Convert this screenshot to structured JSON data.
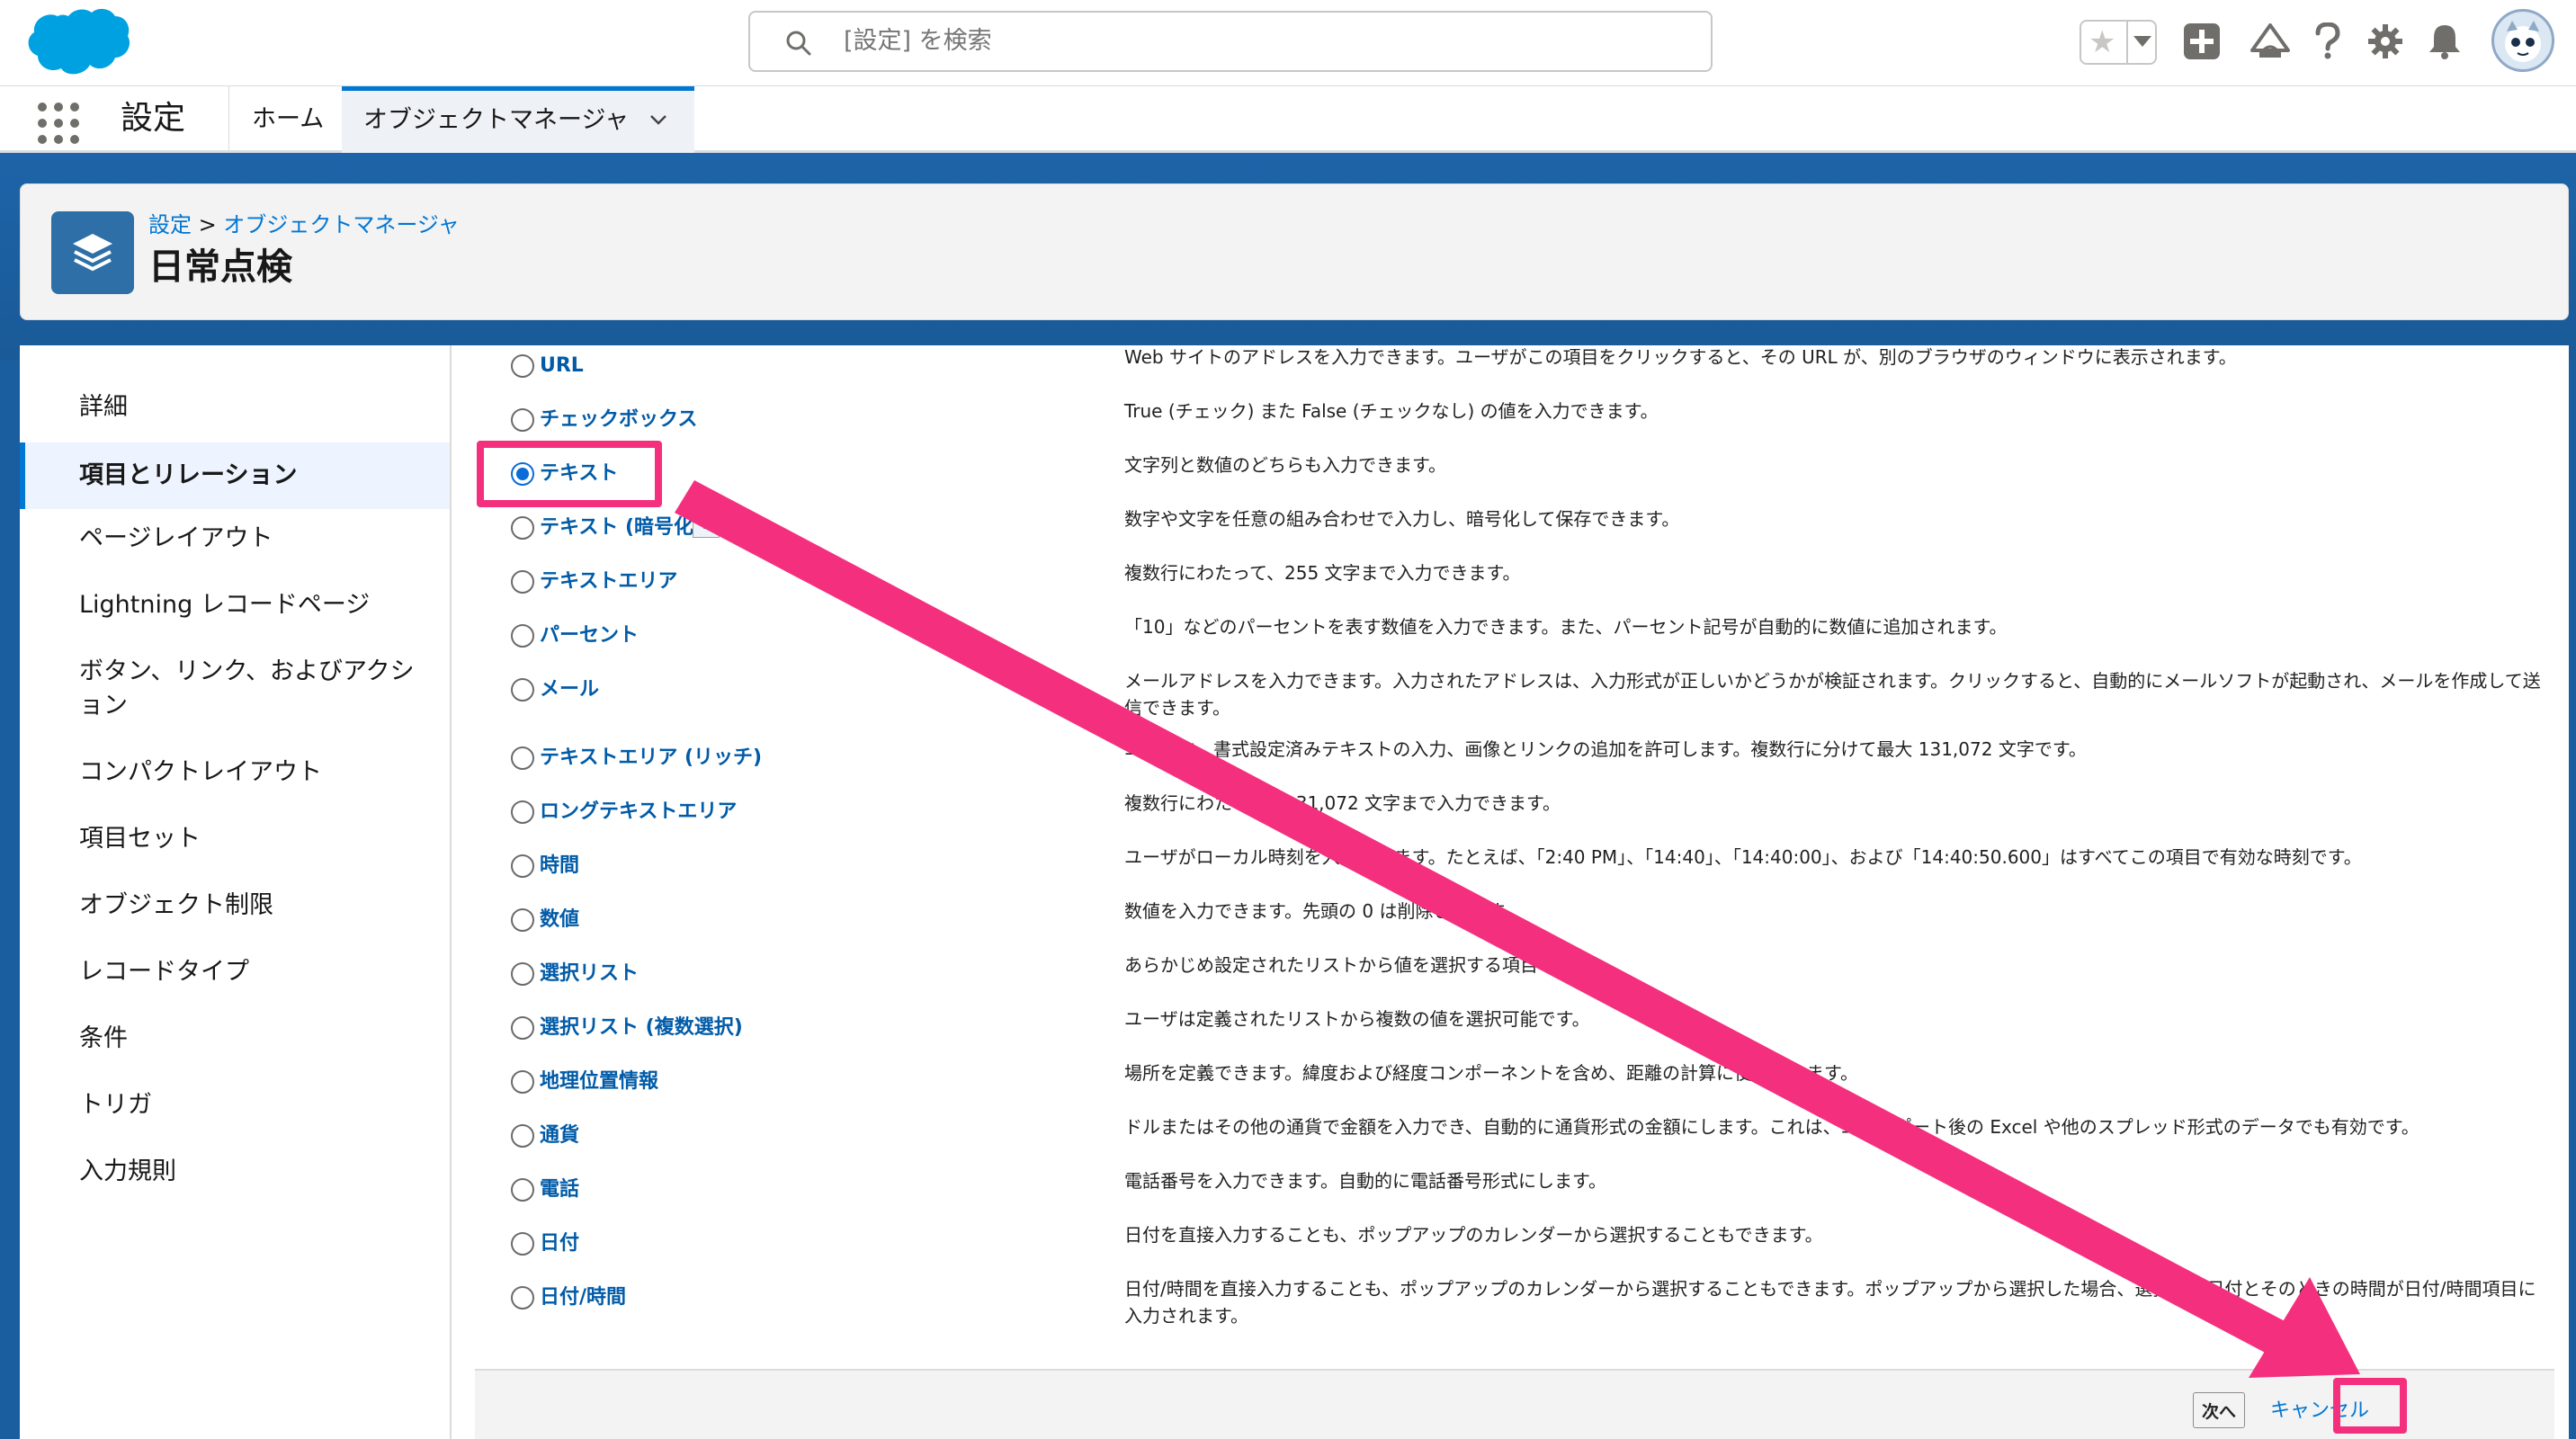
{
  "header": {
    "search_placeholder": "[設定] を検索"
  },
  "context_bar": {
    "app_name": "設定",
    "nav_home": "ホーム",
    "nav_object_manager": "オブジェクトマネージャ"
  },
  "page_header": {
    "breadcrumb_root": "設定",
    "breadcrumb_sep": ">",
    "breadcrumb_current": "オブジェクトマネージャ",
    "title": "日常点検"
  },
  "sidebar": {
    "items": [
      {
        "label": "詳細"
      },
      {
        "label": "項目とリレーション"
      },
      {
        "label": "ページレイアウト"
      },
      {
        "label": "Lightning レコードページ"
      },
      {
        "label": "ボタン、リンク、およびアクション"
      },
      {
        "label": "コンパクトレイアウト"
      },
      {
        "label": "項目セット"
      },
      {
        "label": "オブジェクト制限"
      },
      {
        "label": "レコードタイプ"
      },
      {
        "label": "条件"
      },
      {
        "label": "トリガ"
      },
      {
        "label": "入力規則"
      }
    ],
    "active_index": 1
  },
  "field_types": [
    {
      "label": "URL",
      "desc": "Web サイトのアドレスを入力できます。ユーザがこの項目をクリックすると、その URL が、別のブラウザのウィンドウに表示されます。",
      "checked": false
    },
    {
      "label": "チェックボックス",
      "desc": "True (チェック) また False (チェックなし) の値を入力できます。",
      "checked": false
    },
    {
      "label": "テキスト",
      "desc": "文字列と数値のどちらも入力できます。",
      "checked": true
    },
    {
      "label": "テキスト (暗号化)",
      "desc": "数字や文字を任意の組み合わせで入力し、暗号化して保存できます。",
      "checked": false
    },
    {
      "label": "テキストエリア",
      "desc": "複数行にわたって、255 文字まで入力できます。",
      "checked": false
    },
    {
      "label": "パーセント",
      "desc": "「10」などのパーセントを表す数値を入力できます。また、パーセント記号が自動的に数値に追加されます。",
      "checked": false
    },
    {
      "label": "メール",
      "desc": "メールアドレスを入力できます。入力されたアドレスは、入力形式が正しいかどうかが検証されます。クリックすると、自動的にメールソフトが起動され、メールを作成して送信できます。",
      "checked": false
    },
    {
      "label": "テキストエリア (リッチ)",
      "desc": "ユーザに、書式設定済みテキストの入力、画像とリンクの追加を許可します。複数行に分けて最大 131,072 文字です。",
      "checked": false
    },
    {
      "label": "ロングテキストエリア",
      "desc": "複数行にわたって、131,072 文字まで入力できます。",
      "checked": false
    },
    {
      "label": "時間",
      "desc": "ユーザがローカル時刻を入力できます。たとえば、「2:40 PM」、「14:40」、「14:40:00」、および「14:40:50.600」はすべてこの項目で有効な時刻です。",
      "checked": false
    },
    {
      "label": "数値",
      "desc": "数値を入力できます。先頭の 0 は削除されます。",
      "checked": false
    },
    {
      "label": "選択リスト",
      "desc": "あらかじめ設定されたリストから値を選択する項目です。",
      "checked": false
    },
    {
      "label": "選択リスト (複数選択)",
      "desc": "ユーザは定義されたリストから複数の値を選択可能です。",
      "checked": false
    },
    {
      "label": "地理位置情報",
      "desc": "場所を定義できます。緯度および経度コンポーネントを含め、距離の計算に使用できます。",
      "checked": false
    },
    {
      "label": "通貨",
      "desc": "ドルまたはその他の通貨で金額を入力でき、自動的に通貨形式の金額にします。これは、エクスポート後の Excel や他のスプレッド形式のデータでも有効です。",
      "checked": false
    },
    {
      "label": "電話",
      "desc": "電話番号を入力できます。自動的に電話番号形式にします。",
      "checked": false
    },
    {
      "label": "日付",
      "desc": "日付を直接入力することも、ポップアップのカレンダーから選択することもできます。",
      "checked": false
    },
    {
      "label": "日付/時間",
      "desc": "日付/時間を直接入力することも、ポップアップのカレンダーから選択することもできます。ポップアップから選択した場合、選択した日付とそのときの時間が日付/時間項目に入力されます。",
      "checked": false
    }
  ],
  "info_icon_glyph": "i",
  "buttons": {
    "next": "次へ",
    "cancel": "キャンセル"
  },
  "colors": {
    "brand_blue": "#0176d3",
    "highlight_pink": "#f4307e",
    "page_bg_blue": "#1b5e9f"
  }
}
